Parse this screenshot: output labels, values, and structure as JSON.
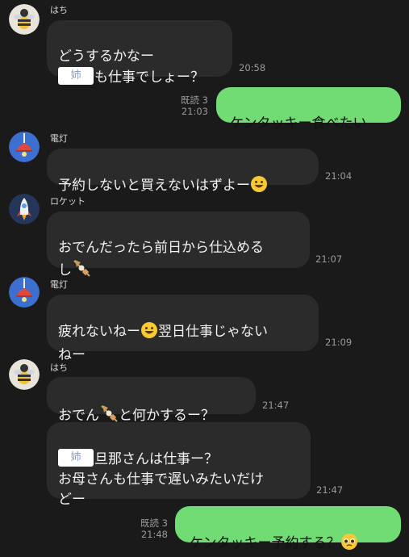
{
  "messages": [
    {
      "sender": "はち",
      "lines": [
        "どうするかなー",
        "も仕事でしょー？"
      ],
      "masked_text": "姉",
      "time": "20:58"
    },
    {
      "read": "既読 3",
      "time": "21:03",
      "text": "ケンタッキー食べたい"
    },
    {
      "sender": "電灯",
      "text": "予約しないと買えないはずよー",
      "emoji": "smiling-face-icon",
      "time": "21:04"
    },
    {
      "sender": "ロケット",
      "lines": [
        "おでんだったら前日から仕込める",
        "し"
      ],
      "emoji": "oden-icon",
      "time": "21:07"
    },
    {
      "sender": "電灯",
      "text_a": "疲れないねー",
      "text_b": "翌日仕事じゃない",
      "text_c": "ねー",
      "emoji": "smiling-face-icon",
      "time": "21:09"
    },
    {
      "sender": "はち",
      "text_a": "おでん",
      "text_b": "と何かするー？",
      "emoji": "oden-icon",
      "time": "21:47"
    },
    {
      "masked_text": "姉",
      "lines": [
        "旦那さんは仕事ー？",
        "お母さんも仕事で遅いみたいだけ",
        "どー"
      ],
      "time": "21:47"
    },
    {
      "read": "既読 3",
      "time": "21:48",
      "text": "ケンタッキー予約する？",
      "emoji": "pleading-face-icon"
    }
  ],
  "colors": {
    "background": "#1a1a1a",
    "bubble_other": "#2b2b2b",
    "bubble_mine": "#71dc73"
  }
}
